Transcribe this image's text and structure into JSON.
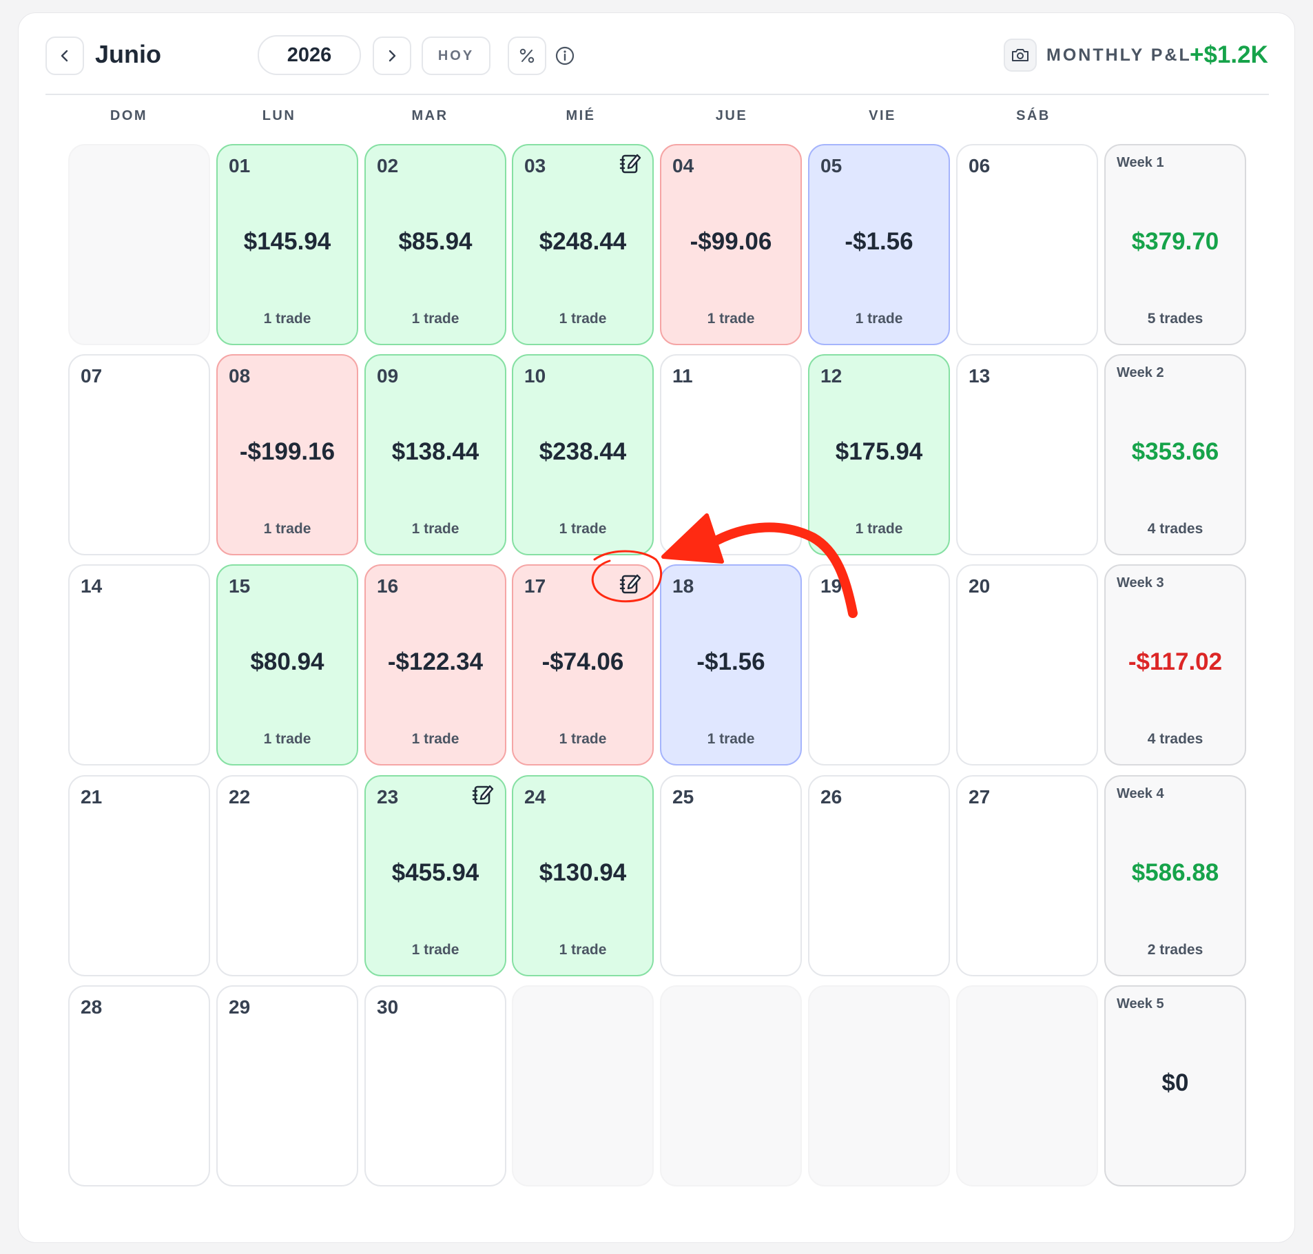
{
  "header": {
    "prev_icon": "chevron-left-icon",
    "month": "Junio",
    "year": "2026",
    "next_icon": "chevron-right-icon",
    "today_label": "HOY",
    "percent_icon": "percent-icon",
    "info_icon": "info-icon",
    "camera_icon": "camera-icon",
    "monthly_label": "MONTHLY P&L",
    "monthly_value": "+$1.2K"
  },
  "weekdays": [
    "DOM",
    "LUN",
    "MAR",
    "MIÉ",
    "JUE",
    "VIE",
    "SÁB"
  ],
  "colors": {
    "win": "#dcfce7",
    "loss": "#fee2e2",
    "breakeven": "#e0e7ff",
    "positive_text": "#16a34a",
    "negative_text": "#dc2626",
    "annotation": "#ff2a12"
  },
  "weeks": [
    {
      "days": [
        {
          "day": "",
          "status": "empty"
        },
        {
          "day": "01",
          "pnl": "$145.94",
          "trades": "1 trade",
          "status": "win"
        },
        {
          "day": "02",
          "pnl": "$85.94",
          "trades": "1 trade",
          "status": "win"
        },
        {
          "day": "03",
          "pnl": "$248.44",
          "trades": "1 trade",
          "status": "win",
          "note": true
        },
        {
          "day": "04",
          "pnl": "-$99.06",
          "trades": "1 trade",
          "status": "loss"
        },
        {
          "day": "05",
          "pnl": "-$1.56",
          "trades": "1 trade",
          "status": "be"
        },
        {
          "day": "06",
          "status": "none"
        }
      ],
      "summary": {
        "label": "Week 1",
        "pnl": "$379.70",
        "trades": "5 trades",
        "sign": "pos"
      }
    },
    {
      "days": [
        {
          "day": "07",
          "status": "none"
        },
        {
          "day": "08",
          "pnl": "-$199.16",
          "trades": "1 trade",
          "status": "loss"
        },
        {
          "day": "09",
          "pnl": "$138.44",
          "trades": "1 trade",
          "status": "win"
        },
        {
          "day": "10",
          "pnl": "$238.44",
          "trades": "1 trade",
          "status": "win"
        },
        {
          "day": "11",
          "status": "none"
        },
        {
          "day": "12",
          "pnl": "$175.94",
          "trades": "1 trade",
          "status": "win"
        },
        {
          "day": "13",
          "status": "none"
        }
      ],
      "summary": {
        "label": "Week 2",
        "pnl": "$353.66",
        "trades": "4 trades",
        "sign": "pos"
      }
    },
    {
      "days": [
        {
          "day": "14",
          "status": "none"
        },
        {
          "day": "15",
          "pnl": "$80.94",
          "trades": "1 trade",
          "status": "win"
        },
        {
          "day": "16",
          "pnl": "-$122.34",
          "trades": "1 trade",
          "status": "loss"
        },
        {
          "day": "17",
          "pnl": "-$74.06",
          "trades": "1 trade",
          "status": "loss",
          "note": true
        },
        {
          "day": "18",
          "pnl": "-$1.56",
          "trades": "1 trade",
          "status": "be"
        },
        {
          "day": "19",
          "status": "none"
        },
        {
          "day": "20",
          "status": "none"
        }
      ],
      "summary": {
        "label": "Week 3",
        "pnl": "-$117.02",
        "trades": "4 trades",
        "sign": "neg"
      }
    },
    {
      "days": [
        {
          "day": "21",
          "status": "none"
        },
        {
          "day": "22",
          "status": "none"
        },
        {
          "day": "23",
          "pnl": "$455.94",
          "trades": "1 trade",
          "status": "win",
          "note": true
        },
        {
          "day": "24",
          "pnl": "$130.94",
          "trades": "1 trade",
          "status": "win"
        },
        {
          "day": "25",
          "status": "none"
        },
        {
          "day": "26",
          "status": "none"
        },
        {
          "day": "27",
          "status": "none"
        }
      ],
      "summary": {
        "label": "Week 4",
        "pnl": "$586.88",
        "trades": "2 trades",
        "sign": "pos"
      }
    },
    {
      "days": [
        {
          "day": "28",
          "status": "none"
        },
        {
          "day": "29",
          "status": "none"
        },
        {
          "day": "30",
          "status": "none"
        },
        {
          "day": "",
          "status": "empty"
        },
        {
          "day": "",
          "status": "empty"
        },
        {
          "day": "",
          "status": "empty"
        },
        {
          "day": "",
          "status": "empty"
        }
      ],
      "summary": {
        "label": "Week 5",
        "pnl": "$0",
        "trades": "",
        "sign": "zero"
      }
    }
  ]
}
